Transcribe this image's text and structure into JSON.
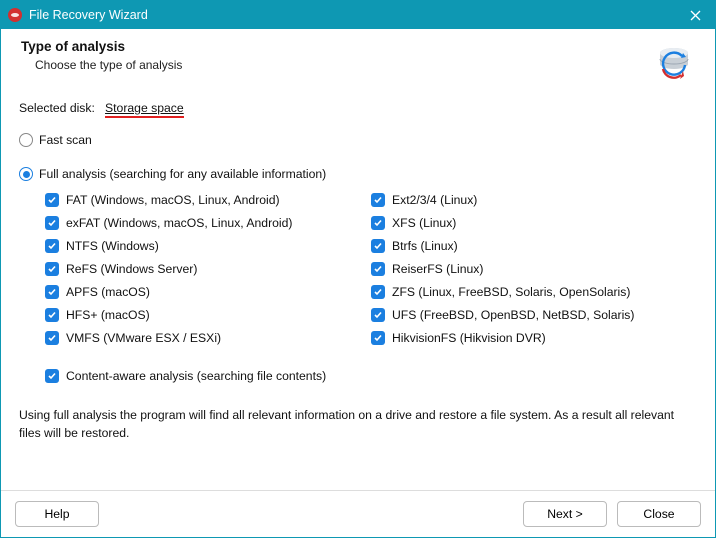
{
  "titlebar": {
    "title": "File Recovery Wizard"
  },
  "header": {
    "heading": "Type of analysis",
    "sub": "Choose the type of analysis"
  },
  "selected_disk": {
    "label": "Selected disk:",
    "name": "Storage space"
  },
  "scan": {
    "fast": {
      "label": "Fast scan",
      "checked": false
    },
    "full": {
      "label": "Full analysis (searching for any available information)",
      "checked": true
    }
  },
  "fs_left": [
    {
      "label": "FAT (Windows, macOS, Linux, Android)"
    },
    {
      "label": "exFAT (Windows, macOS, Linux, Android)"
    },
    {
      "label": "NTFS (Windows)"
    },
    {
      "label": "ReFS (Windows Server)"
    },
    {
      "label": "APFS (macOS)"
    },
    {
      "label": "HFS+ (macOS)"
    },
    {
      "label": "VMFS (VMware ESX / ESXi)"
    }
  ],
  "fs_right": [
    {
      "label": "Ext2/3/4 (Linux)"
    },
    {
      "label": "XFS (Linux)"
    },
    {
      "label": "Btrfs (Linux)"
    },
    {
      "label": "ReiserFS (Linux)"
    },
    {
      "label": "ZFS (Linux, FreeBSD, Solaris, OpenSolaris)"
    },
    {
      "label": "UFS (FreeBSD, OpenBSD, NetBSD, Solaris)"
    },
    {
      "label": "HikvisionFS (Hikvision DVR)"
    }
  ],
  "content_aware": {
    "label": "Content-aware analysis (searching file contents)"
  },
  "description": "Using full analysis the program will find all relevant information on a drive and restore a file system. As a result all relevant files will be restored.",
  "footer": {
    "help": "Help",
    "next": "Next >",
    "close": "Close"
  }
}
